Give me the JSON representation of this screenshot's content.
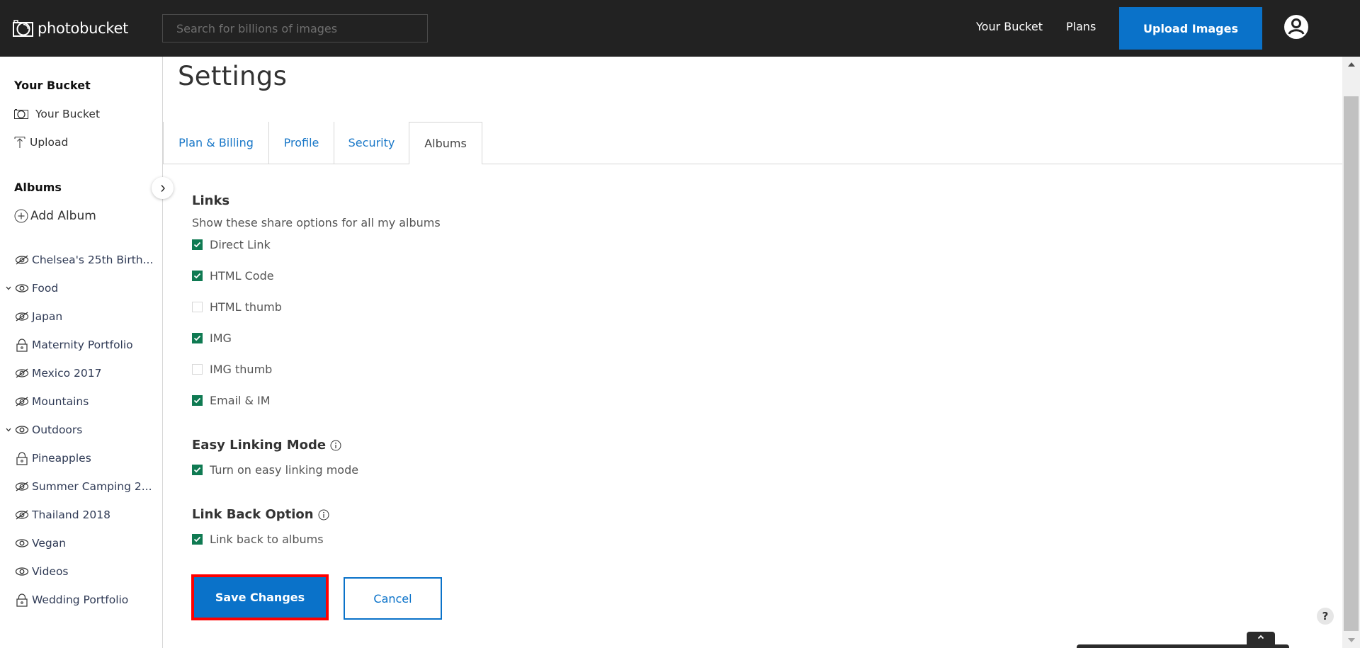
{
  "header": {
    "logo_text": "photobucket",
    "search_placeholder": "Search for billions of images",
    "search_value": "",
    "nav": {
      "your_bucket": "Your Bucket",
      "plans": "Plans"
    },
    "upload_button": "Upload Images"
  },
  "sidebar": {
    "bucket_heading": "Your Bucket",
    "bucket_items": [
      {
        "label": "Your Bucket",
        "icon": "camera-icon"
      },
      {
        "label": "Upload",
        "icon": "upload-icon"
      }
    ],
    "albums_heading": "Albums",
    "add_album": "Add Album",
    "albums": [
      {
        "label": "Chelsea's 25th Birth...",
        "visibility": "hidden",
        "expandable": false
      },
      {
        "label": "Food",
        "visibility": "public",
        "expandable": true
      },
      {
        "label": "Japan",
        "visibility": "hidden",
        "expandable": false
      },
      {
        "label": "Maternity Portfolio",
        "visibility": "private",
        "expandable": false
      },
      {
        "label": "Mexico 2017",
        "visibility": "hidden",
        "expandable": false
      },
      {
        "label": "Mountains",
        "visibility": "hidden",
        "expandable": false
      },
      {
        "label": "Outdoors",
        "visibility": "public",
        "expandable": true
      },
      {
        "label": "Pineapples",
        "visibility": "private",
        "expandable": false
      },
      {
        "label": "Summer Camping 2...",
        "visibility": "hidden",
        "expandable": false
      },
      {
        "label": "Thailand 2018",
        "visibility": "hidden",
        "expandable": false
      },
      {
        "label": "Vegan",
        "visibility": "public",
        "expandable": false
      },
      {
        "label": "Videos",
        "visibility": "public",
        "expandable": false
      },
      {
        "label": "Wedding Portfolio",
        "visibility": "private",
        "expandable": false
      }
    ]
  },
  "main": {
    "title": "Settings",
    "tabs": [
      {
        "label": "Plan & Billing",
        "active": false
      },
      {
        "label": "Profile",
        "active": false
      },
      {
        "label": "Security",
        "active": false
      },
      {
        "label": "Albums",
        "active": true
      }
    ],
    "links": {
      "title": "Links",
      "description": "Show these share options for all my albums",
      "options": [
        {
          "label": "Direct Link",
          "checked": true
        },
        {
          "label": "HTML Code",
          "checked": true
        },
        {
          "label": "HTML thumb",
          "checked": false
        },
        {
          "label": "IMG",
          "checked": true
        },
        {
          "label": "IMG thumb",
          "checked": false
        },
        {
          "label": "Email & IM",
          "checked": true
        }
      ]
    },
    "easy_linking": {
      "title": "Easy Linking Mode",
      "option": {
        "label": "Turn on easy linking mode",
        "checked": true
      }
    },
    "link_back": {
      "title": "Link Back Option",
      "option": {
        "label": "Link back to albums",
        "checked": true
      }
    },
    "save_button": "Save Changes",
    "cancel_button": "Cancel"
  },
  "help": {
    "label": "?"
  },
  "colors": {
    "header_bg": "#222222",
    "accent_blue": "#0a72c9",
    "checkbox_green": "#0f7a52",
    "highlight_red": "#ff0000"
  }
}
